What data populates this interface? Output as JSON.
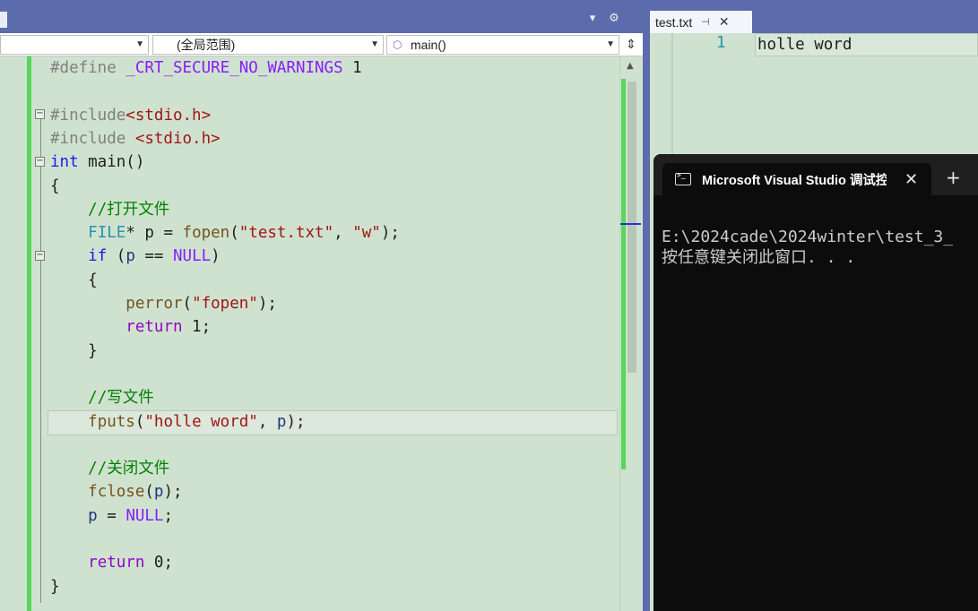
{
  "colors": {
    "titlebar": "#5b6bab",
    "editor_bg": "#cfe2cf",
    "change_bar": "#57d657",
    "console_bg": "#0c0c0c"
  },
  "toolbar": {
    "icons": [
      "chevron-down-icon",
      "gear-icon"
    ]
  },
  "navbar": {
    "project_value": "",
    "scope_value": "(全局范围)",
    "function_value": "main()",
    "function_icon": "cube-icon",
    "split_icon": "split-icon"
  },
  "code": {
    "lines": [
      [
        "#define ",
        "_CRT_SECURE_NO_WARNINGS",
        " 1"
      ],
      [],
      [
        "#include",
        "<stdio.h>"
      ],
      [
        "#include ",
        "<stdio.h>"
      ],
      [
        "int",
        " main()"
      ],
      [
        "{"
      ],
      [
        "    ",
        "//打开文件"
      ],
      [
        "    ",
        "FILE",
        "* p = ",
        "fopen",
        "(",
        "\"test.txt\"",
        ", ",
        "\"w\"",
        ");"
      ],
      [
        "    ",
        "if",
        " (",
        "p",
        " == ",
        "NULL",
        ")"
      ],
      [
        "    {"
      ],
      [
        "        ",
        "perror",
        "(",
        "\"fopen\"",
        ");"
      ],
      [
        "        ",
        "return",
        " 1;"
      ],
      [
        "    }"
      ],
      [],
      [
        "    ",
        "//写文件"
      ],
      [
        "    ",
        "fputs",
        "(",
        "\"holle word\"",
        ", ",
        "p",
        ");"
      ],
      [],
      [
        "    ",
        "//关闭文件"
      ],
      [
        "    ",
        "fclose",
        "(",
        "p",
        ");"
      ],
      [
        "    ",
        "p",
        " = ",
        "NULL",
        ";"
      ],
      [],
      [
        "    ",
        "return",
        " 0;"
      ],
      [
        "}"
      ]
    ]
  },
  "txt_file": {
    "tab_label": "test.txt",
    "line_number": "1",
    "content": "holle word"
  },
  "console": {
    "tab_label": "Microsoft Visual Studio 调试控制台",
    "close_glyph": "✕",
    "new_tab_glyph": "+",
    "output_line_1": "E:\\2024cade\\2024winter\\test_3_",
    "output_line_2": "按任意键关闭此窗口. . ."
  }
}
